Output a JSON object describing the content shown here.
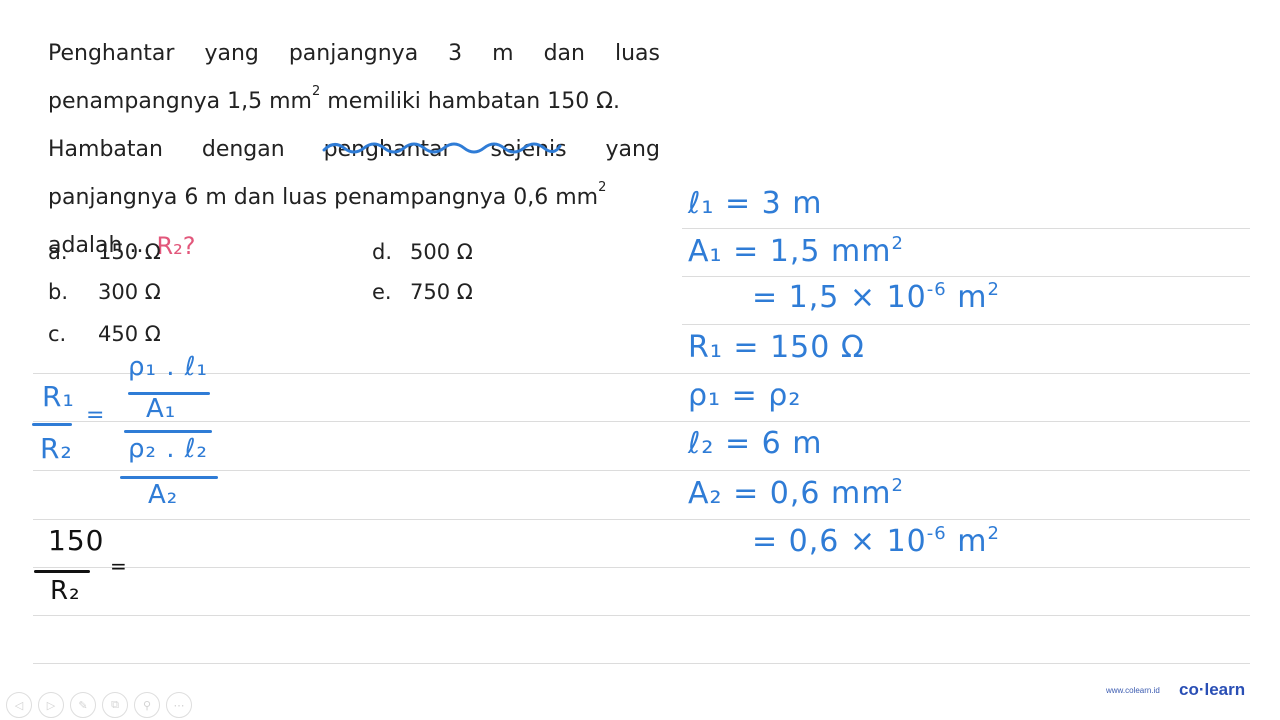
{
  "question": {
    "lines": [
      [
        "Penghantar",
        "yang",
        "panjangnya",
        "3",
        "m",
        "dan",
        "luas"
      ],
      "penampangnya 1,5 mm",
      [
        "Hambatan",
        "dengan",
        "penghantar",
        "sejenis",
        "yang"
      ],
      "panjangnya 6 m dan luas penampangnya 0,6 mm",
      "adalah ..."
    ],
    "line2_suffix": " memiliki hambatan 150 Ω.",
    "superscript": "2",
    "annotation": "R₂?"
  },
  "options": [
    {
      "letter": "a.",
      "value": "150 Ω"
    },
    {
      "letter": "b.",
      "value": "300 Ω"
    },
    {
      "letter": "c.",
      "value": "450 Ω"
    },
    {
      "letter": "d.",
      "value": "500 Ω"
    },
    {
      "letter": "e.",
      "value": "750 Ω"
    }
  ],
  "known": [
    {
      "text": "ℓ₁ = 3 m"
    },
    {
      "text": "A₁ = 1,5 mm",
      "sup": "2"
    },
    {
      "text": "= 1,5 × 10",
      "sup": "-6",
      "after": " m",
      "sup2": "2"
    },
    {
      "text": "R₁ = 150 Ω"
    },
    {
      "text": "ρ₁ = ρ₂"
    },
    {
      "text": "ℓ₂ = 6 m"
    },
    {
      "text": "A₂ = 0,6 mm",
      "sup": "2"
    },
    {
      "text": "= 0,6 × 10",
      "sup": "-6",
      "after": " m",
      "sup2": "2"
    }
  ],
  "working": {
    "lhs_num": "R₁",
    "lhs_den": "R₂",
    "eq": "=",
    "rhs_top_num": "ρ₁ . ℓ₁",
    "rhs_top_den": "A₁",
    "rhs_bot_num": "ρ₂ . ℓ₂",
    "rhs_bot_den": "A₂",
    "step2_num": "150",
    "step2_den": "R₂",
    "step2_eq": "="
  },
  "toolbar": {
    "icons": [
      "prev-icon",
      "next-icon",
      "pen-icon",
      "copy-icon",
      "zoom-icon",
      "more-icon"
    ],
    "glyphs": [
      "◁",
      "▷",
      "✎",
      "⧉",
      "⚲",
      "⋯"
    ]
  },
  "brand": {
    "url": "www.colearn.id",
    "name": "co·learn"
  },
  "colors": {
    "ink_blue": "#2f7cd6",
    "ink_pink": "#e2577b",
    "brand": "#2a4fb5"
  }
}
